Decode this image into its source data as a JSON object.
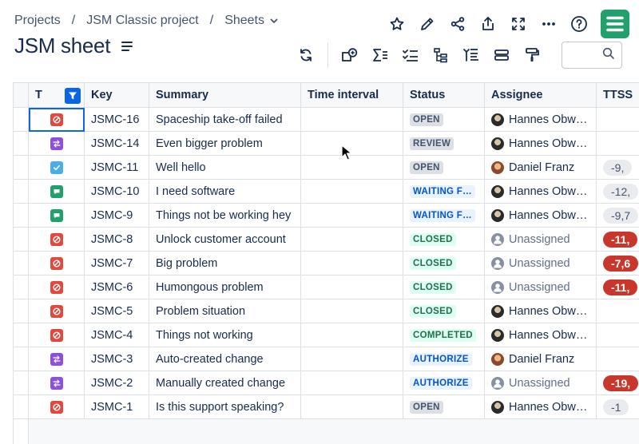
{
  "breadcrumb": {
    "items": [
      "Projects",
      "JSM Classic project",
      "Sheets"
    ]
  },
  "page": {
    "title": "JSM sheet"
  },
  "top_actions": [
    "star-icon",
    "edit-icon",
    "share-icon",
    "export-icon",
    "fullscreen-icon",
    "more-icon",
    "help-icon"
  ],
  "toolbar": {
    "icons": [
      "refresh-icon",
      "add-view-icon",
      "sum-icon",
      "checklist-icon",
      "hierarchy-icon",
      "filter-list-icon",
      "row-height-icon",
      "paint-format-icon"
    ],
    "search_placeholder": ""
  },
  "columns": [
    "T",
    "Key",
    "Summary",
    "Time interval",
    "Status",
    "Assignee",
    "TTSS"
  ],
  "rows": [
    {
      "type": "incident",
      "key": "JSMC-16",
      "summary": "Spaceship take-off failed",
      "time_interval": "",
      "status": "OPEN",
      "status_kind": "open",
      "assignee": "Hannes Obw…",
      "assignee_kind": "hannes",
      "ttss": "",
      "ttss_kind": ""
    },
    {
      "type": "change",
      "key": "JSMC-14",
      "summary": "Even bigger problem",
      "time_interval": "",
      "status": "REVIEW",
      "status_kind": "review",
      "assignee": "Hannes Obw…",
      "assignee_kind": "hannes",
      "ttss": "",
      "ttss_kind": ""
    },
    {
      "type": "task",
      "key": "JSMC-11",
      "summary": "Well hello",
      "time_interval": "",
      "status": "OPEN",
      "status_kind": "open",
      "assignee": "Daniel Franz",
      "assignee_kind": "daniel",
      "ttss": "-9,",
      "ttss_kind": "neutral"
    },
    {
      "type": "service",
      "key": "JSMC-10",
      "summary": "I need software",
      "time_interval": "",
      "status": "WAITING F…",
      "status_kind": "waiting",
      "assignee": "Hannes Obw…",
      "assignee_kind": "hannes",
      "ttss": "-12,",
      "ttss_kind": "neutral"
    },
    {
      "type": "service",
      "key": "JSMC-9",
      "summary": "Things not be working hey",
      "time_interval": "",
      "status": "WAITING F…",
      "status_kind": "waiting",
      "assignee": "Hannes Obw…",
      "assignee_kind": "hannes",
      "ttss": "-9,7",
      "ttss_kind": "neutral"
    },
    {
      "type": "incident",
      "key": "JSMC-8",
      "summary": "Unlock customer account",
      "time_interval": "",
      "status": "CLOSED",
      "status_kind": "closed",
      "assignee": "Unassigned",
      "assignee_kind": "none",
      "ttss": "-11,",
      "ttss_kind": "red"
    },
    {
      "type": "incident",
      "key": "JSMC-7",
      "summary": "Big problem",
      "time_interval": "",
      "status": "CLOSED",
      "status_kind": "closed",
      "assignee": "Unassigned",
      "assignee_kind": "none",
      "ttss": "-7,6",
      "ttss_kind": "red"
    },
    {
      "type": "incident",
      "key": "JSMC-6",
      "summary": "Humongous problem",
      "time_interval": "",
      "status": "CLOSED",
      "status_kind": "closed",
      "assignee": "Unassigned",
      "assignee_kind": "none",
      "ttss": "-11,",
      "ttss_kind": "red"
    },
    {
      "type": "incident",
      "key": "JSMC-5",
      "summary": "Problem situation",
      "time_interval": "",
      "status": "CLOSED",
      "status_kind": "closed",
      "assignee": "Hannes Obw…",
      "assignee_kind": "hannes",
      "ttss": "",
      "ttss_kind": ""
    },
    {
      "type": "incident",
      "key": "JSMC-4",
      "summary": "Things not working",
      "time_interval": "",
      "status": "COMPLETED",
      "status_kind": "completed",
      "assignee": "Hannes Obw…",
      "assignee_kind": "hannes",
      "ttss": "",
      "ttss_kind": ""
    },
    {
      "type": "change",
      "key": "JSMC-3",
      "summary": "Auto-created change",
      "time_interval": "",
      "status": "AUTHORIZE",
      "status_kind": "authorize",
      "assignee": "Daniel Franz",
      "assignee_kind": "daniel",
      "ttss": "",
      "ttss_kind": ""
    },
    {
      "type": "change",
      "key": "JSMC-2",
      "summary": "Manually created change",
      "time_interval": "",
      "status": "AUTHORIZE",
      "status_kind": "authorize",
      "assignee": "Unassigned",
      "assignee_kind": "none",
      "ttss": "-19,",
      "ttss_kind": "red"
    },
    {
      "type": "incident",
      "key": "JSMC-1",
      "summary": "Is this support speaking?",
      "time_interval": "",
      "status": "OPEN",
      "status_kind": "open",
      "assignee": "Hannes Obw…",
      "assignee_kind": "hannes",
      "ttss": "-1",
      "ttss_kind": "neutral"
    }
  ],
  "colors": {
    "incident": "#e2483d",
    "change": "#8f4fde",
    "task": "#4bade8",
    "service": "#22a06b",
    "accent": "#0c66e4",
    "logo": "#22a06b"
  }
}
